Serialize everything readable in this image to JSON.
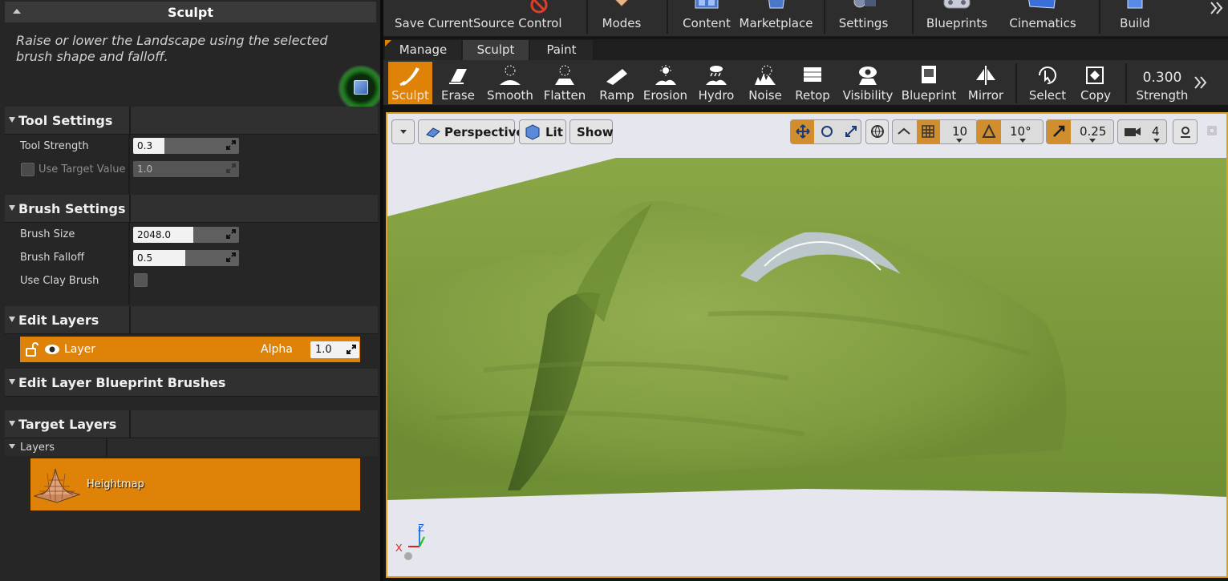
{
  "panel": {
    "title": "Sculpt",
    "description": "Raise or lower the Landscape using the selected brush shape and falloff.",
    "tool_settings": {
      "title": "Tool Settings",
      "tool_strength_label": "Tool Strength",
      "tool_strength_value": "0.3",
      "tool_strength_fraction": 0.3,
      "use_target_label": "Use Target Value",
      "use_target_value": "1.0",
      "use_target_checked": false
    },
    "brush_settings": {
      "title": "Brush Settings",
      "brush_size_label": "Brush Size",
      "brush_size_value": "2048.0",
      "brush_falloff_label": "Brush Falloff",
      "brush_falloff_value": "0.5",
      "use_clay_label": "Use Clay Brush",
      "use_clay_checked": false
    },
    "edit_layers": {
      "title": "Edit Layers",
      "layer_name": "Layer",
      "alpha_label": "Alpha",
      "alpha_value": "1.0"
    },
    "edit_layer_bp": {
      "title": "Edit Layer Blueprint Brushes"
    },
    "target_layers": {
      "title": "Target Layers",
      "layers_label": "Layers",
      "heightmap_label": "Heightmap"
    }
  },
  "toolbar": {
    "save_current": "Save Current",
    "source_control": "Source Control",
    "modes": "Modes",
    "content": "Content",
    "marketplace": "Marketplace",
    "settings": "Settings",
    "blueprints": "Blueprints",
    "cinematics": "Cinematics",
    "build": "Build"
  },
  "mode_tabs": [
    "Manage",
    "Sculpt",
    "Paint"
  ],
  "sculpt_tools": [
    "Sculpt",
    "Erase",
    "Smooth",
    "Flatten",
    "Ramp",
    "Erosion",
    "Hydro",
    "Noise",
    "Retop",
    "Visibility",
    "Blueprint",
    "Mirror",
    "Select",
    "Copy"
  ],
  "strength": {
    "value": "0.300",
    "label": "Strength"
  },
  "viewport": {
    "perspective": "Perspective",
    "lit": "Lit",
    "show": "Show",
    "grid_snap": "10",
    "rotation_snap": "10°",
    "scale_snap": "0.25",
    "camera_speed": "4",
    "axis_x": "X",
    "axis_z": "Z"
  },
  "colors": {
    "accent": "#de8208",
    "panel_bg": "#262626",
    "viewport_border": "#e0a020",
    "grass": "#7a9a3a"
  }
}
